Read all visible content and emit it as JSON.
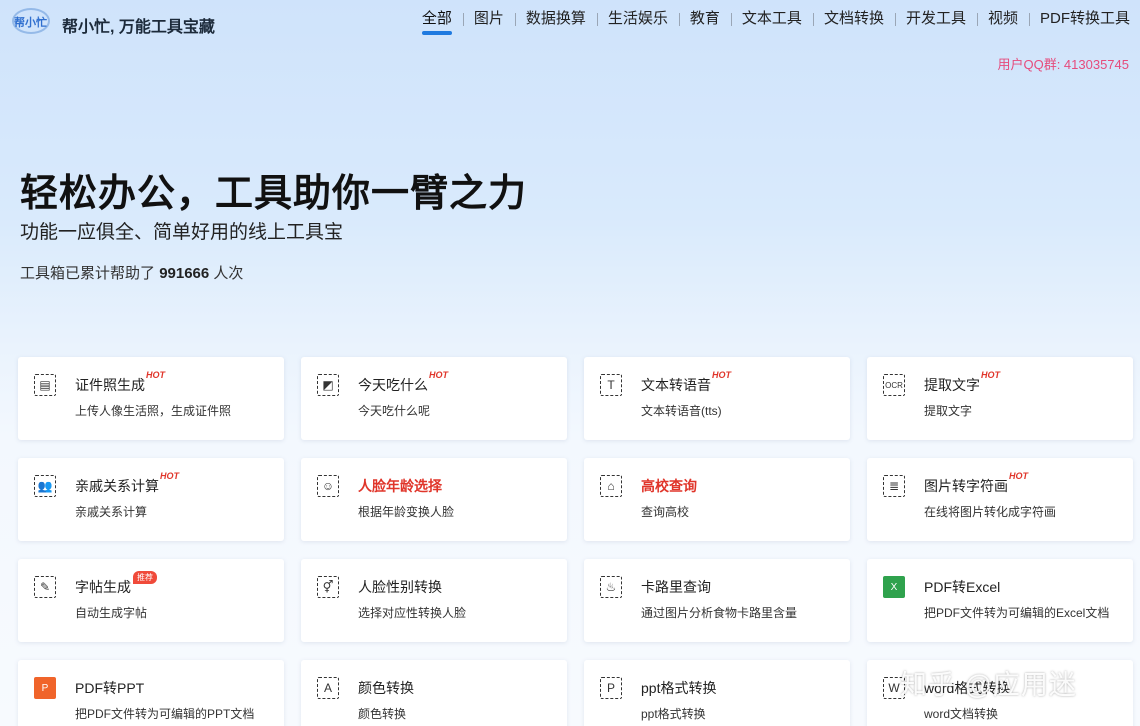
{
  "header": {
    "logo_text": "帮小忙",
    "site_title": "帮小忙, 万能工具宝藏",
    "nav": [
      "全部",
      "图片",
      "数据换算",
      "生活娱乐",
      "教育",
      "文本工具",
      "文档转换",
      "开发工具",
      "视频",
      "PDF转换工具"
    ],
    "qq_group": "用户QQ群: 413035745"
  },
  "hero": {
    "title": "轻松办公，工具助你一臂之力",
    "subtitle": "功能一应俱全、简单好用的线上工具宝",
    "count_prefix": "工具箱已累计帮助了",
    "count_value": "991666",
    "count_suffix": "人次"
  },
  "tools": [
    {
      "name": "证件照生成",
      "desc": "上传人像生活照，生成证件照",
      "badge": "HOT",
      "icon": "id-card-icon",
      "glyph": "▤"
    },
    {
      "name": "今天吃什么",
      "desc": "今天吃什么呢",
      "badge": "HOT",
      "icon": "food-icon",
      "glyph": "◩"
    },
    {
      "name": "文本转语音",
      "desc": "文本转语音(tts)",
      "badge": "HOT",
      "icon": "text-to-speech-icon",
      "glyph": "T"
    },
    {
      "name": "提取文字",
      "desc": "提取文字",
      "badge": "HOT",
      "icon": "ocr-icon",
      "glyph": "OCR"
    },
    {
      "name": "亲戚关系计算",
      "desc": "亲戚关系计算",
      "badge": "HOT",
      "icon": "relatives-icon",
      "glyph": "👥"
    },
    {
      "name": "人脸年龄选择",
      "desc": "根据年龄变换人脸",
      "badge": "",
      "icon": "face-age-icon",
      "glyph": "☺",
      "highlight": true
    },
    {
      "name": "高校查询",
      "desc": "查询高校",
      "badge": "",
      "icon": "school-icon",
      "glyph": "⌂",
      "highlight": true
    },
    {
      "name": "图片转字符画",
      "desc": "在线将图片转化成字符画",
      "badge": "HOT",
      "icon": "ascii-art-icon",
      "glyph": "≣"
    },
    {
      "name": "字帖生成",
      "desc": "自动生成字帖",
      "badge": "推荐",
      "icon": "copybook-icon",
      "glyph": "✎"
    },
    {
      "name": "人脸性别转换",
      "desc": "选择对应性转换人脸",
      "badge": "",
      "icon": "gender-swap-icon",
      "glyph": "⚥"
    },
    {
      "name": "卡路里查询",
      "desc": "通过图片分析食物卡路里含量",
      "badge": "",
      "icon": "calorie-icon",
      "glyph": "♨"
    },
    {
      "name": "PDF转Excel",
      "desc": "把PDF文件转为可编辑的Excel文档",
      "badge": "",
      "icon": "pdf-excel-icon",
      "glyph": "X",
      "style": "green"
    },
    {
      "name": "PDF转PPT",
      "desc": "把PDF文件转为可编辑的PPT文档",
      "badge": "",
      "icon": "pdf-ppt-icon",
      "glyph": "P",
      "style": "orange"
    },
    {
      "name": "颜色转换",
      "desc": "颜色转换",
      "badge": "",
      "icon": "color-convert-icon",
      "glyph": "A"
    },
    {
      "name": "ppt格式转换",
      "desc": "ppt格式转换",
      "badge": "",
      "icon": "ppt-format-icon",
      "glyph": "P"
    },
    {
      "name": "word格式转换",
      "desc": "word文档转换",
      "badge": "",
      "icon": "word-format-icon",
      "glyph": "W"
    }
  ],
  "watermark": "知乎 @应用迷"
}
